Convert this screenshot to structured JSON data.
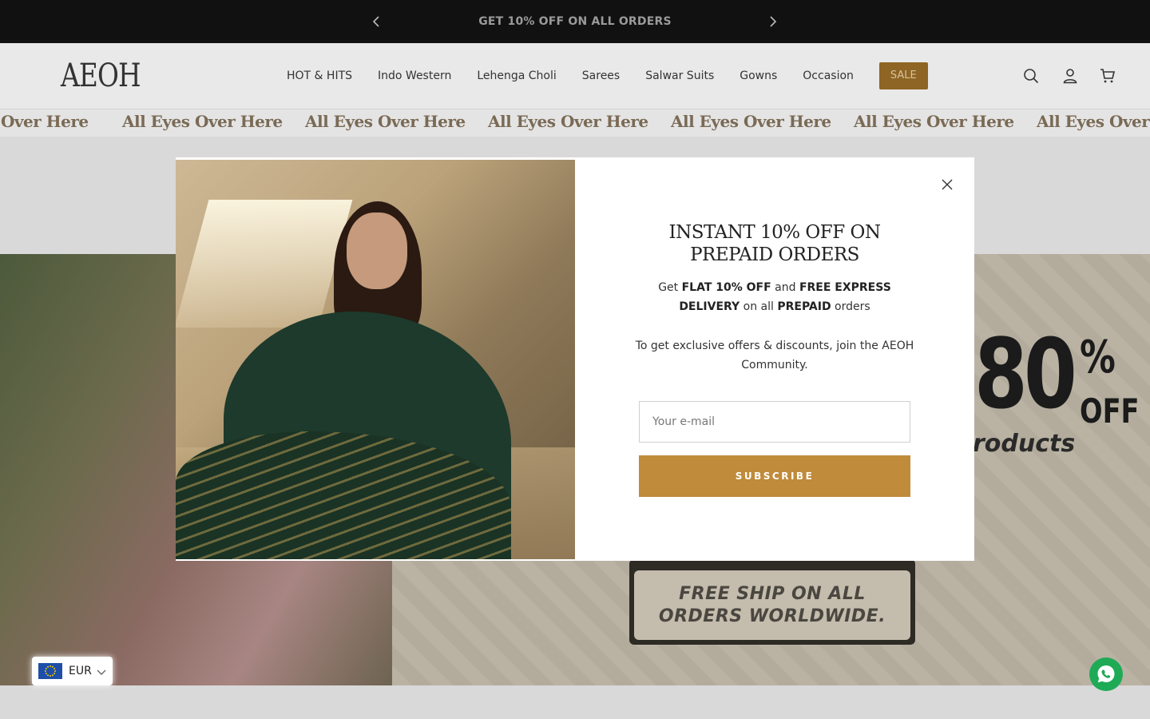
{
  "announcement": {
    "message": "GET 10% OFF ON ALL ORDERS"
  },
  "header": {
    "logo": "AEOH",
    "nav": [
      "HOT & HITS",
      "Indo Western",
      "Lehenga Choli",
      "Sarees",
      "Salwar Suits",
      "Gowns",
      "Occasion"
    ],
    "sale_label": "SALE",
    "icons": [
      "search-icon",
      "account-icon",
      "cart-icon"
    ]
  },
  "marquee": {
    "text": "All Eyes Over Here",
    "first_fragment": "Over Here",
    "last_fragment": "All Eyes Over H"
  },
  "hero": {
    "discount_number": "80",
    "percent_symbol": "%",
    "off_label": "OFF",
    "products_fragment": "roducts",
    "ship_line1": "FREE SHIP ON ALL",
    "ship_line2": "ORDERS WORLDWIDE."
  },
  "popup": {
    "title": "INSTANT 10% OFF ON PREPAID ORDERS",
    "text_get": "Get",
    "text_flat": "FLAT 10% OFF",
    "text_and": "and",
    "text_delivery": "FREE EXPRESS DELIVERY",
    "text_on_all": "on all",
    "text_prepaid": "PREPAID",
    "text_orders": "orders",
    "text2": "To get exclusive offers & discounts, join the AEOH Community.",
    "email_placeholder": "Your e-mail",
    "subscribe_label": "SUBSCRIBE"
  },
  "currency": {
    "code": "EUR"
  },
  "colors": {
    "accent": "#c08b3a",
    "sale_bg": "#8e6524",
    "whatsapp": "#1faa56"
  }
}
